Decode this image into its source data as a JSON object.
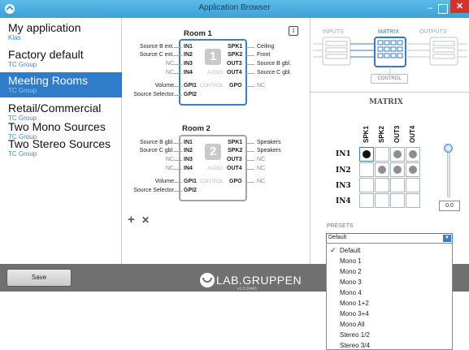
{
  "window": {
    "title": "Application Browser",
    "min_glyph": "–",
    "close_glyph": "✕"
  },
  "sidebar": {
    "items": [
      {
        "title": "My application",
        "subtitle": "Klas"
      },
      {
        "title": "Factory default",
        "subtitle": "TC Group"
      },
      {
        "title": "Meeting Rooms",
        "subtitle": "TC Group",
        "active": true
      },
      {
        "title": "Retail/Commercial",
        "subtitle": "TC Group"
      },
      {
        "title": "Two Mono Sources",
        "subtitle": "TC Group"
      },
      {
        "title": "Two Stereo Sources",
        "subtitle": "TC Group"
      }
    ]
  },
  "rooms": [
    {
      "title": "Room 1",
      "number": "1",
      "left_labels": [
        "Source B ext.",
        "Source C ext.",
        "NC",
        "NC",
        "Volume",
        "Source Selector"
      ],
      "inputs": [
        "IN1",
        "IN2",
        "IN3",
        "IN4",
        "GPI1",
        "GPI2"
      ],
      "outputs": [
        "SPK1",
        "SPK2",
        "OUT3",
        "OUT4",
        "GPO"
      ],
      "audio_label": "AUDIO",
      "control_label": "CONTROL",
      "right_labels": [
        "Ceiling",
        "Front",
        "Source B gbl.",
        "Source C gbl.",
        "NC"
      ]
    },
    {
      "title": "Room 2",
      "number": "2",
      "left_labels": [
        "Source B gbl.",
        "Source C gbl.",
        "NC",
        "NC",
        "Volume",
        "Source Selector"
      ],
      "inputs": [
        "IN1",
        "IN2",
        "IN3",
        "IN4",
        "GPI1",
        "GPI2"
      ],
      "outputs": [
        "SPK1",
        "SPK2",
        "OUT3",
        "OUT4",
        "GPO"
      ],
      "audio_label": "AUDIO",
      "control_label": "CONTROL",
      "right_labels": [
        "Speakers",
        "Speakers",
        "NC",
        "NC",
        "NC"
      ]
    }
  ],
  "room_actions": {
    "add_glyph": "+",
    "delete_glyph": "✕"
  },
  "info_glyph": "i",
  "tabs": {
    "inputs": "INPUTS",
    "matrix": "MATRIX",
    "outputs": "OUTPUTS",
    "control": "CONTROL"
  },
  "matrix": {
    "title": "MATRIX",
    "columns": [
      "SPK1",
      "SPK2",
      "OUT3",
      "OUT4"
    ],
    "rows": [
      "IN1",
      "IN2",
      "IN3",
      "IN4"
    ],
    "cells": [
      [
        "black",
        "none",
        "gray",
        "gray"
      ],
      [
        "none",
        "gray",
        "gray",
        "gray"
      ],
      [
        "none",
        "none",
        "none",
        "none"
      ],
      [
        "none",
        "none",
        "none",
        "none"
      ]
    ],
    "slider_value": "0.0"
  },
  "presets": {
    "label": "PRESETS",
    "selected": "Default",
    "options": [
      "Default",
      "Mono 1",
      "Mono 2",
      "Mono 3",
      "Mono 4",
      "Mono 1+2",
      "Mono 3+4",
      "Mono All",
      "Stereo 1/2",
      "Stereo 3/4"
    ]
  },
  "footer": {
    "save_label": "Save",
    "brand": "LAB.GRUPPEN",
    "version": "v1.0.2r443"
  },
  "colors": {
    "accent": "#2f7dc9",
    "titlebar": "#4fb1e2",
    "close": "#d2332e",
    "bottombar": "#707070"
  }
}
